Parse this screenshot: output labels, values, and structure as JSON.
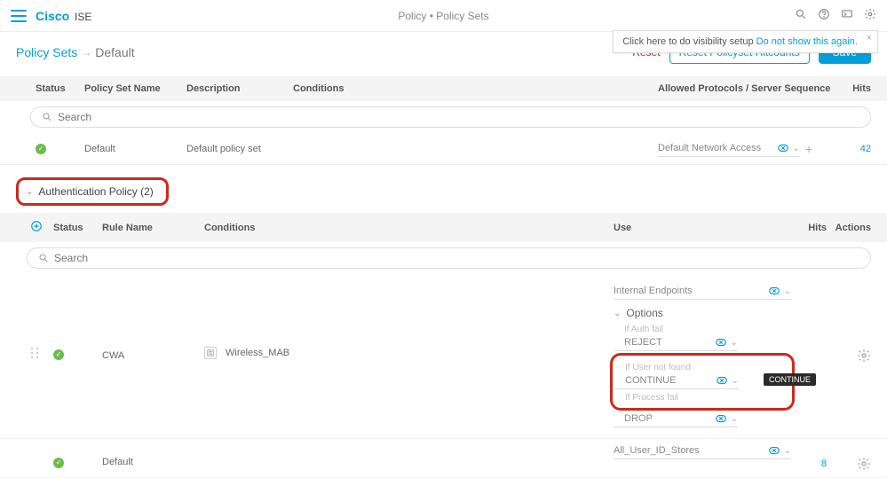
{
  "header": {
    "brand": "Cisco",
    "brand_suffix": "ISE",
    "page_title": "Policy • Policy Sets"
  },
  "visibility_popup": {
    "text": "Click here to do visibility setup ",
    "link": "Do not show this again."
  },
  "breadcrumb": {
    "root": "Policy Sets",
    "current": "Default"
  },
  "actions": {
    "reset": "Reset",
    "reset_hitcounts": "Reset Policyset Hitcounts",
    "save": "Save"
  },
  "ps_columns": {
    "status": "Status",
    "name": "Policy Set Name",
    "desc": "Description",
    "cond": "Conditions",
    "allowed": "Allowed Protocols / Server Sequence",
    "hits": "Hits"
  },
  "search_placeholder": "Search",
  "ps_row": {
    "name": "Default",
    "desc": "Default policy set",
    "allowed": "Default Network Access",
    "hits": "42"
  },
  "auth_section": {
    "title": "Authentication Policy (2)"
  },
  "rule_columns": {
    "status": "Status",
    "name": "Rule Name",
    "cond": "Conditions",
    "use": "Use",
    "hits": "Hits",
    "actions": "Actions"
  },
  "cwa_rule": {
    "name": "CWA",
    "condition": "Wireless_MAB",
    "use_select": "Internal Endpoints",
    "options_label": "Options",
    "opts": {
      "auth_fail_label": "If Auth fail",
      "auth_fail_value": "REJECT",
      "user_nf_label": "If User not found",
      "user_nf_value": "CONTINUE",
      "process_fail_label": "If Process fail",
      "process_fail_value": "DROP"
    },
    "tooltip": "CONTINUE"
  },
  "default_rule": {
    "name": "Default",
    "use_select": "All_User_ID_Stores",
    "hits": "8"
  }
}
